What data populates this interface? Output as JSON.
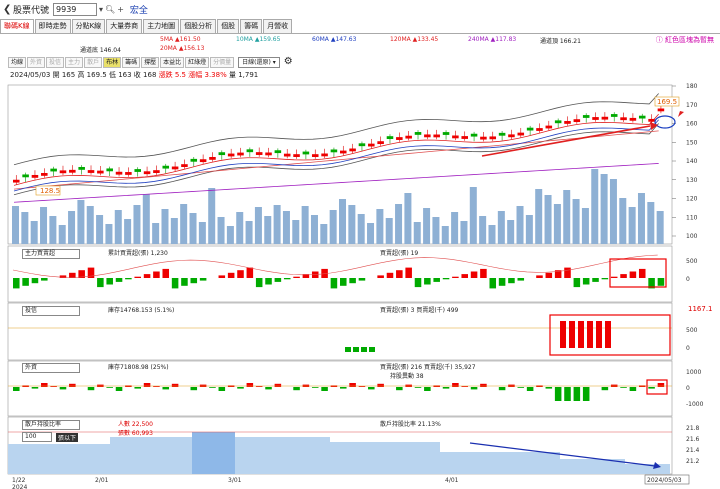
{
  "header": {
    "back_icon": "back-arrow-icon",
    "code_label": "股票代號",
    "code_value": "9939",
    "stock_name": "宏全"
  },
  "tabs": [
    "聯碼K線",
    "即時走勢",
    "分點K線",
    "大量券商",
    "主力地圖",
    "個股分析",
    "個股",
    "籌碼",
    "月營收"
  ],
  "active_tab": 0,
  "help_note": "ⓘ 紅色區塊為暫無",
  "ma": {
    "ma5": "5MA ▲161.50",
    "ma10": "10MA ▲159.65",
    "ma60": "60MA ▲147.63",
    "ma120": "120MA ▲133.45",
    "ma240": "240MA ▲117.83",
    "band_top": "通道頂 166.21",
    "band_bottom": "通道底 146.04",
    "ma20": "20MA ▲156.13",
    "colors": {
      "ma5": "#e0a020",
      "ma10": "#20a0a0",
      "ma60": "#2040c0",
      "ma120": "#e02020",
      "ma240": "#a020c0"
    }
  },
  "toolbar": {
    "buttons": [
      "均線",
      "外資",
      "投信",
      "主力",
      "散戶",
      "布林",
      "籌碼",
      "撐壓",
      "本益比",
      "紅綠燈",
      "分價量"
    ],
    "active": "布林",
    "dim": [
      "外資",
      "投信",
      "主力",
      "散戶",
      "分價量"
    ],
    "period": "日線(還原)"
  },
  "info": {
    "date": "2024/05/03",
    "open_label": "開",
    "open": "165",
    "high_label": "高",
    "high": "169.5",
    "low_label": "低",
    "low": "163",
    "close_label": "收",
    "close": "168",
    "chg_label": "漲跌",
    "chg": "5.5",
    "pct_label": "漲幅",
    "pct": "3.38%",
    "vol_label": "量",
    "vol": "1,791"
  },
  "price_axis": [
    "180",
    "170",
    "160",
    "150",
    "140",
    "130",
    "120",
    "110",
    "100"
  ],
  "price_marks": {
    "high": "169.5",
    "low": "128.5"
  },
  "panels": {
    "main_force": {
      "select": "主力買賣超",
      "line_label": "累計買賣超(張) 1,230",
      "bar_label": "買賣超(張) 19",
      "axis": [
        "500",
        "0"
      ]
    },
    "trust": {
      "select": "投信",
      "line_label": "庫存14768.153 (5.1%)",
      "bar_label": "買賣超(張) 3 買賣超(千) 499",
      "axis": [
        "500",
        "0"
      ],
      "right_value": "1167.1"
    },
    "foreign": {
      "select": "外資",
      "line_label": "庫存71808.98 (25%)",
      "bar_label": "買賣超(張) 216 買賣超(千) 35,927",
      "bar_label2": "持股異動 38",
      "axis": [
        "1000",
        "0",
        "-1000"
      ]
    },
    "retail": {
      "select": "散戶持股比率",
      "sub_select": "100",
      "sub_select2": "張以下",
      "line_label": "人數 22,500",
      "line_label2": "張數 60,993",
      "bar_label": "散戶持股比率 21.13%",
      "axis": [
        "21.8",
        "21.6",
        "21.4",
        "21.2"
      ]
    }
  },
  "dates": [
    "1/22",
    "2024",
    "2/01",
    "3/01",
    "4/01",
    "2024/05/03"
  ]
}
